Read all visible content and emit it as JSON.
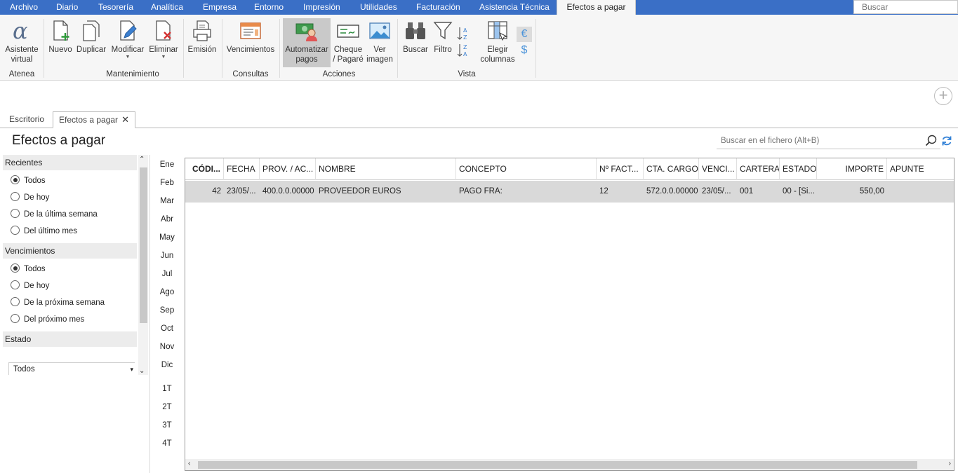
{
  "menu": [
    "Archivo",
    "Diario",
    "Tesorería",
    "Analítica",
    "Empresa",
    "Entorno",
    "Impresión",
    "Utilidades",
    "Facturación",
    "Asistencia Técnica",
    "Efectos a pagar"
  ],
  "top_search_placeholder": "Buscar",
  "ribbon": {
    "asistente": "Asistente\nvirtual",
    "nuevo": "Nuevo",
    "duplicar": "Duplicar",
    "modificar": "Modificar",
    "eliminar": "Eliminar",
    "emision": "Emisión",
    "vencimientos": "Vencimientos",
    "automatizar": "Automatizar\npagos",
    "cheque": "Cheque\n/ Pagaré",
    "ver_imagen": "Ver\nimagen",
    "buscar": "Buscar",
    "filtro": "Filtro",
    "elegir": "Elegir\ncolumnas",
    "groups": [
      "Atenea",
      "Mantenimiento",
      "Consultas",
      "Acciones",
      "Vista"
    ]
  },
  "tabs": [
    "Escritorio",
    "Efectos a pagar"
  ],
  "page_title": "Efectos a pagar",
  "file_search_placeholder": "Buscar en el fichero (Alt+B)",
  "filters": {
    "recientes": {
      "title": "Recientes",
      "options": [
        "Todos",
        "De hoy",
        "De la última semana",
        "Del último mes"
      ],
      "selected": 0
    },
    "vencimientos": {
      "title": "Vencimientos",
      "options": [
        "Todos",
        "De hoy",
        "De la próxima semana",
        "Del próximo mes"
      ],
      "selected": 0
    },
    "estado": {
      "title": "Estado",
      "value": "Todos"
    }
  },
  "months": [
    "Ene",
    "Feb",
    "Mar",
    "Abr",
    "May",
    "Jun",
    "Jul",
    "Ago",
    "Sep",
    "Oct",
    "Nov",
    "Dic"
  ],
  "quarters": [
    "1T",
    "2T",
    "3T",
    "4T"
  ],
  "table": {
    "columns": [
      "CÓDI...",
      "FECHA",
      "PROV. / AC...",
      "NOMBRE",
      "CONCEPTO",
      "Nº FACT...",
      "CTA. CARGO",
      "VENCI...",
      "CARTERA",
      "ESTADO",
      "IMPORTE",
      "APUNTE"
    ],
    "rows": [
      [
        "42",
        "23/05/...",
        "400.0.0.00000",
        "PROVEEDOR EUROS",
        "PAGO FRA:",
        "12",
        "572.0.0.00000",
        "23/05/...",
        "001",
        "00 - [Si...",
        "550,00",
        ""
      ]
    ]
  },
  "colors": {
    "menubar": "#3a6fc6",
    "selected_row": "#d9d9d9",
    "accent_blue": "#2f7fd6"
  }
}
